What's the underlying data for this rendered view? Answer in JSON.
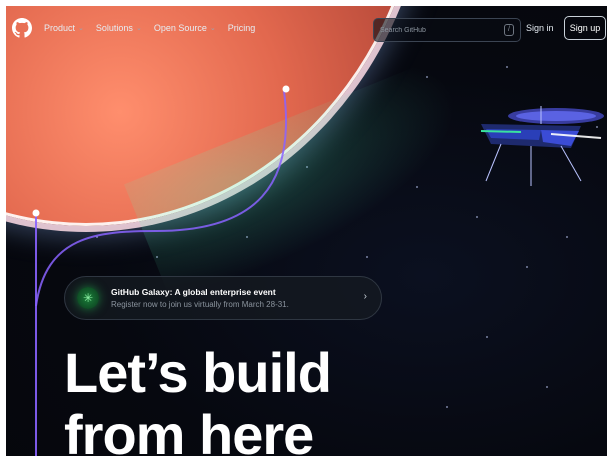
{
  "header": {
    "nav": [
      {
        "label": "Product"
      },
      {
        "label": "Solutions"
      },
      {
        "label": "Open Source"
      },
      {
        "label": "Pricing"
      }
    ],
    "search_placeholder": "Search GitHub",
    "search_shortcut": "/",
    "signin_label": "Sign in",
    "signup_label": "Sign up"
  },
  "announcement": {
    "title": "GitHub Galaxy: A global enterprise event",
    "subtitle": "Register now to join us virtually from March 28-31."
  },
  "hero": {
    "line1": "Let’s build",
    "line2": "from here"
  },
  "colors": {
    "background": "#0d1117",
    "planet": "#e2684e",
    "accent_green": "#1b7f3a",
    "orbit_purple": "#8a63ff"
  },
  "icons": {
    "logo": "github-octocat-icon",
    "nav_chevron": "chevron-down-icon",
    "announcement": "sparkle-icon",
    "arrow": "chevron-right-icon"
  }
}
